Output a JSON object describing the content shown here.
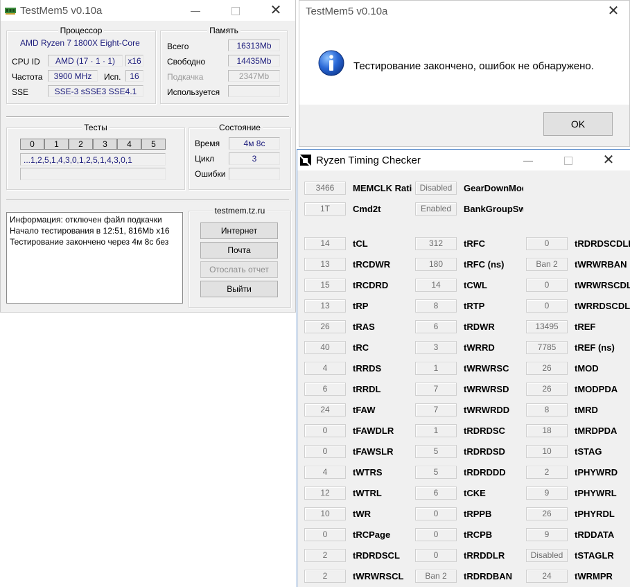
{
  "testmem": {
    "title": "TestMem5 v0.10a",
    "processor": {
      "group_title": "Процессор",
      "name": "AMD Ryzen 7 1800X Eight-Core",
      "cpuid_label": "CPU ID",
      "cpuid_value": "AMD  (17 · 1 · 1)",
      "cpuid_x": "x16",
      "freq_label": "Частота",
      "freq_value": "3900 MHz",
      "used_label": "Исп.",
      "used_value": "16",
      "sse_label": "SSE",
      "sse_value": "SSE-3 sSSE3 SSE4.1"
    },
    "memory": {
      "group_title": "Память",
      "rows": [
        {
          "label": "Всего",
          "value": "16313Mb",
          "dim": false
        },
        {
          "label": "Свободно",
          "value": "14435Mb",
          "dim": false
        },
        {
          "label": "Подкачка",
          "value": "2347Mb",
          "dim": true
        },
        {
          "label": "Используется",
          "value": "",
          "dim": false
        }
      ]
    },
    "tests": {
      "group_title": "Тесты",
      "cells": [
        "0",
        "1",
        "2",
        "3",
        "4",
        "5"
      ],
      "sequence": "...1,2,5,1,4,3,0,1,2,5,1,4,3,0,1",
      "extra": ""
    },
    "status": {
      "group_title": "Состояние",
      "time_label": "Время",
      "time_value": "4м 8с",
      "cycle_label": "Цикл",
      "cycle_value": "3",
      "errors_label": "Ошибки",
      "errors_value": ""
    },
    "log": [
      "Информация: отключен файл подкачки",
      "Начало тестирования в 12:51, 816Mb x16",
      "Тестирование закончено через 4м 8с без"
    ],
    "links": {
      "group_title": "testmem.tz.ru",
      "internet": "Интернет",
      "mail": "Почта",
      "send_report": "Отослать отчет",
      "exit": "Выйти"
    }
  },
  "msgbox": {
    "title": "TestMem5 v0.10a",
    "message": "Тестирование закончено, ошибок не обнаружено.",
    "ok": "OK"
  },
  "rtc": {
    "title": "Ryzen Timing Checker",
    "top": [
      {
        "v1": "3466",
        "n1": "MEMCLK Ratio",
        "v2": "Disabled",
        "n2": "GearDownMode"
      },
      {
        "v1": "1T",
        "n1": "Cmd2t",
        "v2": "Enabled",
        "n2": "BankGroupSwap"
      }
    ],
    "rows": [
      {
        "v1": "14",
        "n1": "tCL",
        "v2": "312",
        "n2": "tRFC",
        "v3": "0",
        "n3": "tRDRDSCDLR"
      },
      {
        "v1": "13",
        "n1": "tRCDWR",
        "v2": "180",
        "n2": "tRFC (ns)",
        "v3": "Ban 2",
        "n3": "tWRWRBAN"
      },
      {
        "v1": "15",
        "n1": "tRCDRD",
        "v2": "14",
        "n2": "tCWL",
        "v3": "0",
        "n3": "tWRWRSCDLR"
      },
      {
        "v1": "13",
        "n1": "tRP",
        "v2": "8",
        "n2": "tRTP",
        "v3": "0",
        "n3": "tWRRDSCDLR"
      },
      {
        "v1": "26",
        "n1": "tRAS",
        "v2": "6",
        "n2": "tRDWR",
        "v3": "13495",
        "n3": "tREF"
      },
      {
        "v1": "40",
        "n1": "tRC",
        "v2": "3",
        "n2": "tWRRD",
        "v3": "7785",
        "n3": "tREF (ns)"
      },
      {
        "v1": "4",
        "n1": "tRRDS",
        "v2": "1",
        "n2": "tWRWRSC",
        "v3": "26",
        "n3": "tMOD"
      },
      {
        "v1": "6",
        "n1": "tRRDL",
        "v2": "7",
        "n2": "tWRWRSD",
        "v3": "26",
        "n3": "tMODPDA"
      },
      {
        "v1": "24",
        "n1": "tFAW",
        "v2": "7",
        "n2": "tWRWRDD",
        "v3": "8",
        "n3": "tMRD"
      },
      {
        "v1": "0",
        "n1": "tFAWDLR",
        "v2": "1",
        "n2": "tRDRDSC",
        "v3": "18",
        "n3": "tMRDPDA"
      },
      {
        "v1": "0",
        "n1": "tFAWSLR",
        "v2": "5",
        "n2": "tRDRDSD",
        "v3": "10",
        "n3": "tSTAG"
      },
      {
        "v1": "4",
        "n1": "tWTRS",
        "v2": "5",
        "n2": "tRDRDDD",
        "v3": "2",
        "n3": "tPHYWRD"
      },
      {
        "v1": "12",
        "n1": "tWTRL",
        "v2": "6",
        "n2": "tCKE",
        "v3": "9",
        "n3": "tPHYWRL"
      },
      {
        "v1": "10",
        "n1": "tWR",
        "v2": "0",
        "n2": "tRPPB",
        "v3": "26",
        "n3": "tPHYRDL"
      },
      {
        "v1": "0",
        "n1": "tRCPage",
        "v2": "0",
        "n2": "tRCPB",
        "v3": "9",
        "n3": "tRDDATA"
      },
      {
        "v1": "2",
        "n1": "tRDRDSCL",
        "v2": "0",
        "n2": "tRRDDLR",
        "v3": "Disabled",
        "n3": "tSTAGLR"
      },
      {
        "v1": "2",
        "n1": "tWRWRSCL",
        "v2": "Ban 2",
        "n2": "tRDRDBAN",
        "v3": "24",
        "n3": "tWRMPR"
      }
    ]
  }
}
